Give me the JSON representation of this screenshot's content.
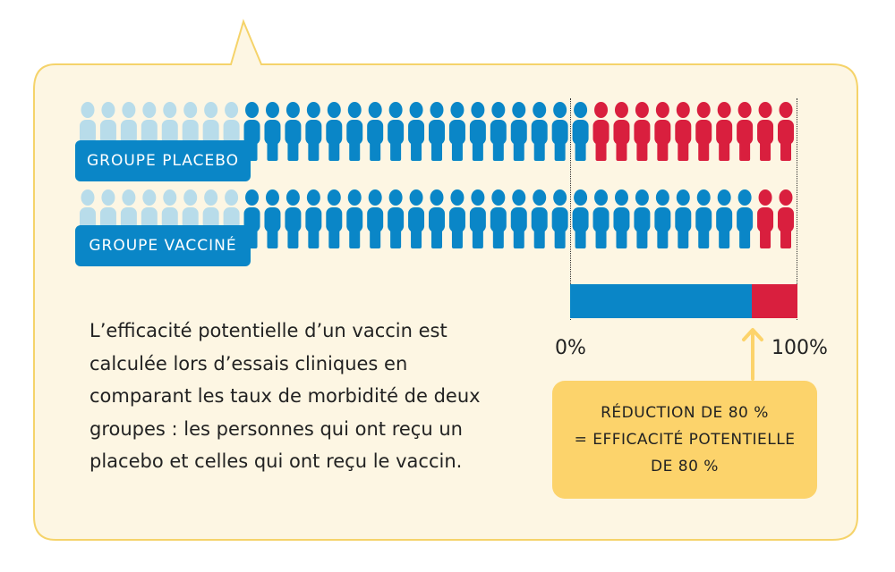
{
  "groups": {
    "placebo": {
      "label": "GROUPE PLACEBO",
      "ill_count": 10
    },
    "vaccine": {
      "label": "GROUPE VACCINÉ",
      "ill_count": 2
    }
  },
  "people_per_row": 35,
  "faded_per_row": 8,
  "efficacy": {
    "value_percent": 80,
    "tick_start": "0%",
    "tick_end": "100%"
  },
  "result": {
    "lines": [
      "RÉDUCTION DE 80 %",
      "= EFFICACITÉ POTENTIELLE",
      "DE 80 %"
    ]
  },
  "explanation": {
    "lines": [
      "L’efficacité potentielle d’un vaccin est",
      "calculée lors d’essais cliniques en",
      "comparant les taux de morbidité de deux",
      "groupes : les personnes qui ont reçu un",
      "placebo et celles qui ont reçu le vaccin."
    ]
  },
  "colors": {
    "bubble_fill": "#fdf6e3",
    "bubble_border": "#f5d36a",
    "blue": "#0a86c7",
    "red": "#d91f3e",
    "faded": "#b8dcea",
    "result_fill": "#fcd36b"
  }
}
